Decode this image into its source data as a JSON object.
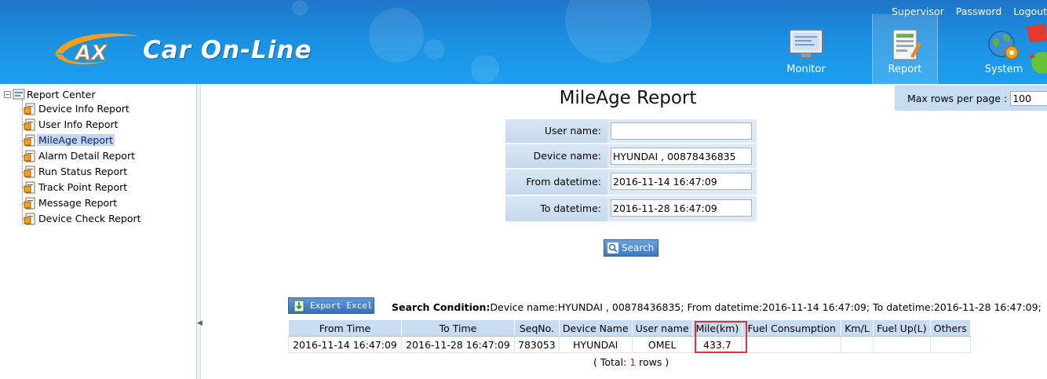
{
  "header": {
    "app_title": "Car On-Line",
    "top_links": [
      "Supervisor",
      "Password",
      "Logout"
    ],
    "nav": [
      {
        "label": "Monitor",
        "icon": "monitor-icon"
      },
      {
        "label": "Report",
        "icon": "report-icon",
        "active": true
      },
      {
        "label": "System",
        "icon": "globe-gear-icon"
      }
    ]
  },
  "sidebar": {
    "root": "Report Center",
    "items": [
      {
        "label": "Device Info Report"
      },
      {
        "label": "User Info Report"
      },
      {
        "label": "MileAge Report",
        "selected": true
      },
      {
        "label": "Alarm Detail Report"
      },
      {
        "label": "Run Status Report"
      },
      {
        "label": "Track Point Report"
      },
      {
        "label": "Message Report"
      },
      {
        "label": "Device Check Report"
      }
    ]
  },
  "main": {
    "title": "MileAge Report",
    "max_rows_label": "Max rows per page :",
    "max_rows_value": "100",
    "form": {
      "user_name_label": "User name:",
      "user_name_value": "",
      "device_name_label": "Device name:",
      "device_name_value": "HYUNDAI , 00878436835",
      "from_label": "From datetime:",
      "from_value": "2016-11-14 16:47:09",
      "to_label": "To datetime:",
      "to_value": "2016-11-28 16:47:09"
    },
    "search_label": "Search",
    "export_label": "Export Excel",
    "condition_label": "Search Condition:",
    "condition_text": "Device name:HYUNDAI , 00878436835; From datetime:2016-11-14 16:47:09; To datetime:2016-11-28 16:47:09;",
    "table": {
      "headers": [
        "From Time",
        "To Time",
        "SeqNo.",
        "Device Name",
        "User name",
        "Mile(km)",
        "Fuel Consumption",
        "Km/L",
        "Fuel Up(L)",
        "Others"
      ],
      "rows": [
        [
          "2016-11-14 16:47:09",
          "2016-11-28 16:47:09",
          "783053",
          "HYUNDAI",
          "OMEL",
          "433.7",
          "",
          "",
          "",
          ""
        ]
      ]
    },
    "total_prefix": "( Total: ",
    "total_count": "1",
    "total_suffix": " rows )"
  },
  "colors": {
    "header_blue": "#1b8fe0",
    "form_blue": "#c6d9ee",
    "highlight_red": "#e0333a"
  }
}
